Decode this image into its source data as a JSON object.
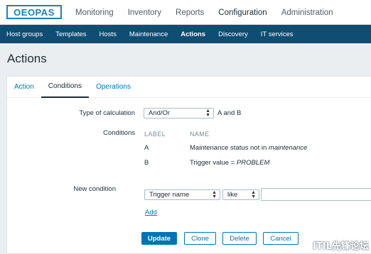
{
  "brand": {
    "logo_text": "OEOPAS"
  },
  "main_menu": [
    {
      "label": "Monitoring"
    },
    {
      "label": "Inventory"
    },
    {
      "label": "Reports"
    },
    {
      "label": "Configuration"
    },
    {
      "label": "Administration"
    }
  ],
  "sub_menu": [
    {
      "label": "Host groups"
    },
    {
      "label": "Templates"
    },
    {
      "label": "Hosts"
    },
    {
      "label": "Maintenance"
    },
    {
      "label": "Actions"
    },
    {
      "label": "Discovery"
    },
    {
      "label": "IT services"
    }
  ],
  "page": {
    "title": "Actions"
  },
  "tabs": [
    {
      "label": "Action"
    },
    {
      "label": "Conditions"
    },
    {
      "label": "Operations"
    }
  ],
  "form": {
    "calc_label": "Type of calculation",
    "calc_value": "And/Or",
    "calc_expression": "A and B",
    "conditions_label": "Conditions",
    "col_label": "LABEL",
    "col_name": "NAME",
    "conditions": [
      {
        "label": "A",
        "name_prefix": "Maintenance status not in ",
        "name_emph": "maintenance"
      },
      {
        "label": "B",
        "name_prefix": "Trigger value = ",
        "name_emph": "PROBLEM"
      }
    ],
    "new_condition_label": "New condition",
    "new_condition_type": "Trigger name",
    "new_condition_operator": "like",
    "new_condition_value": "",
    "add_link": "Add"
  },
  "buttons": {
    "update": "Update",
    "clone": "Clone",
    "delete": "Delete",
    "cancel": "Cancel"
  },
  "watermark": "ITIL先锋论坛"
}
